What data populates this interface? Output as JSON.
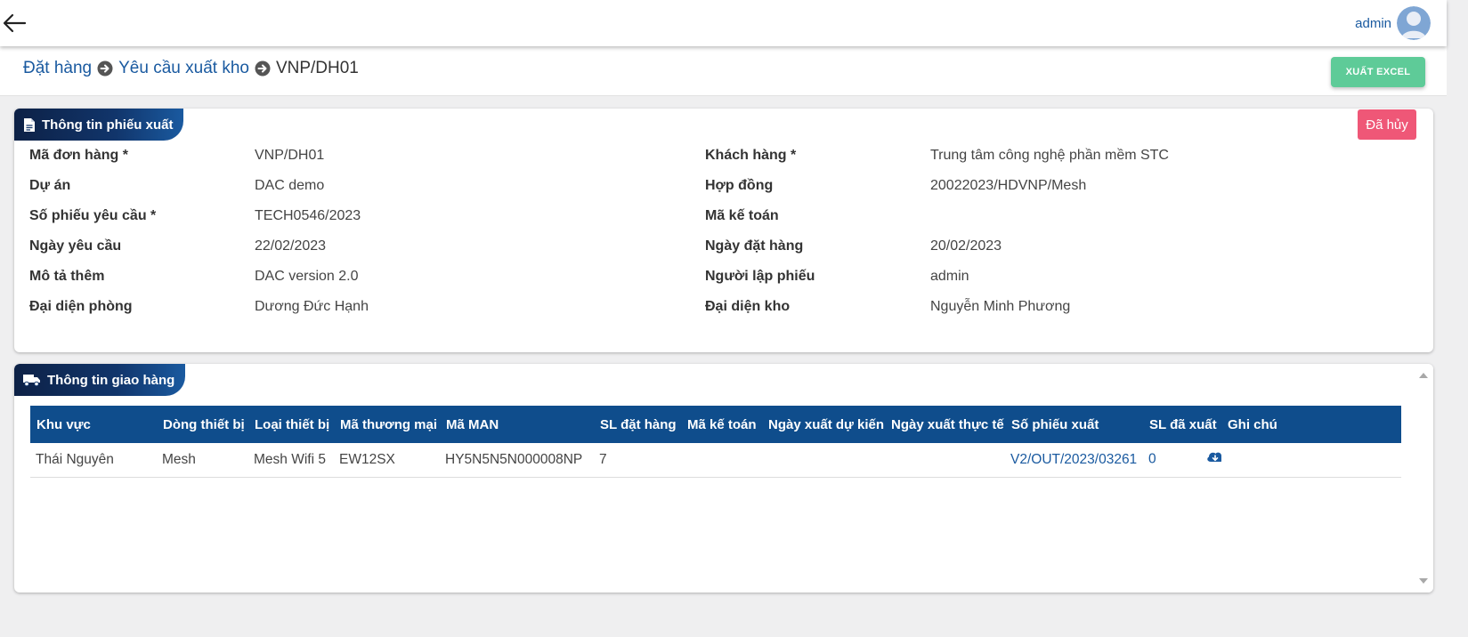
{
  "header": {
    "back_icon": "arrow-left-icon",
    "user_name": "admin",
    "avatar_icon": "user-avatar-icon"
  },
  "breadcrumb": {
    "items": [
      "Đặt hàng",
      "Yêu cầu xuất kho",
      "VNP/DH01"
    ],
    "separator_icon": "arrow-circle-right-icon"
  },
  "toolbar": {
    "export_label": "XUẤT EXCEL",
    "export_color": "#5ecb98"
  },
  "info_card": {
    "title": "Thông tin phiếu xuất",
    "icon": "document-icon",
    "status": "Đã hủy",
    "status_color": "#ef5777",
    "left": [
      {
        "label": "Mã đơn hàng *",
        "value": "VNP/DH01"
      },
      {
        "label": "Dự án",
        "value": "DAC demo"
      },
      {
        "label": "Số phiếu yêu cầu *",
        "value": "TECH0546/2023"
      },
      {
        "label": "Ngày yêu cầu",
        "value": "22/02/2023"
      },
      {
        "label": "Mô tả thêm",
        "value": "DAC version 2.0"
      },
      {
        "label": "Đại diện phòng",
        "value": "Dương Đức Hạnh"
      }
    ],
    "right": [
      {
        "label": "Khách hàng *",
        "value": "Trung tâm công nghệ phần mềm STC"
      },
      {
        "label": "Hợp đồng",
        "value": "20022023/HDVNP/Mesh"
      },
      {
        "label": "Mã kế toán",
        "value": ""
      },
      {
        "label": "Ngày đặt hàng",
        "value": "20/02/2023"
      },
      {
        "label": "Người lập phiếu",
        "value": "admin"
      },
      {
        "label": "Đại diện kho",
        "value": "Nguyễn Minh Phương"
      }
    ]
  },
  "delivery_card": {
    "title": "Thông tin giao hàng",
    "icon": "truck-icon",
    "columns": [
      "Khu vực",
      "Dòng thiết bị",
      "Loại thiết bị",
      "Mã thương mại",
      "Mã MAN",
      "SL đặt hàng",
      "Mã kế toán",
      "Ngày xuất dự kiến",
      "Ngày xuất thực tế",
      "Số phiếu xuất",
      "SL đã xuất",
      "Ghi chú"
    ],
    "rows": [
      {
        "khu_vuc": "Thái Nguyên",
        "dong_thiet_bi": "Mesh",
        "loai_thiet_bi": "Mesh Wifi 5",
        "ma_thuong_mai": "EW12SX",
        "ma_man": "HY5N5N5N000008NP",
        "sl_dat_hang": "7",
        "ma_ke_toan": "",
        "ngay_xuat_du_kien": "",
        "ngay_xuat_thuc_te": "",
        "so_phieu_xuat": "V2/OUT/2023/03261",
        "sl_da_xuat": "0",
        "action_icon": "cloud-download-icon",
        "ghi_chu": ""
      }
    ]
  },
  "colors": {
    "brand_blue": "#1a5aa0",
    "table_header": "#0f4d8c",
    "tab_dark": "#0d2146"
  }
}
